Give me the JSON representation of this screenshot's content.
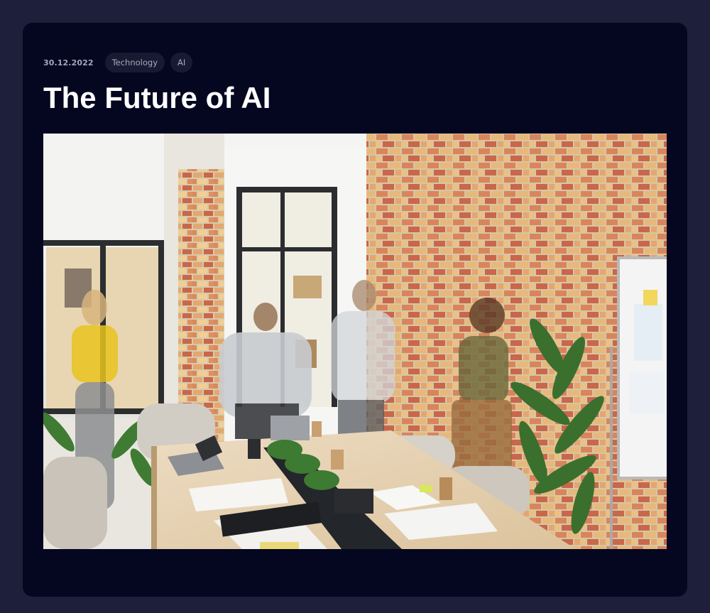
{
  "post": {
    "date": "30.12.2022",
    "tags": [
      {
        "label": "Technology"
      },
      {
        "label": "AI"
      }
    ],
    "title": "The Future of AI"
  },
  "colors": {
    "page_background": "#1e1f3b",
    "card_background": "#050720",
    "tag_background": "#171a33",
    "tag_text": "#a7aab9",
    "title_text": "#ffffff"
  }
}
